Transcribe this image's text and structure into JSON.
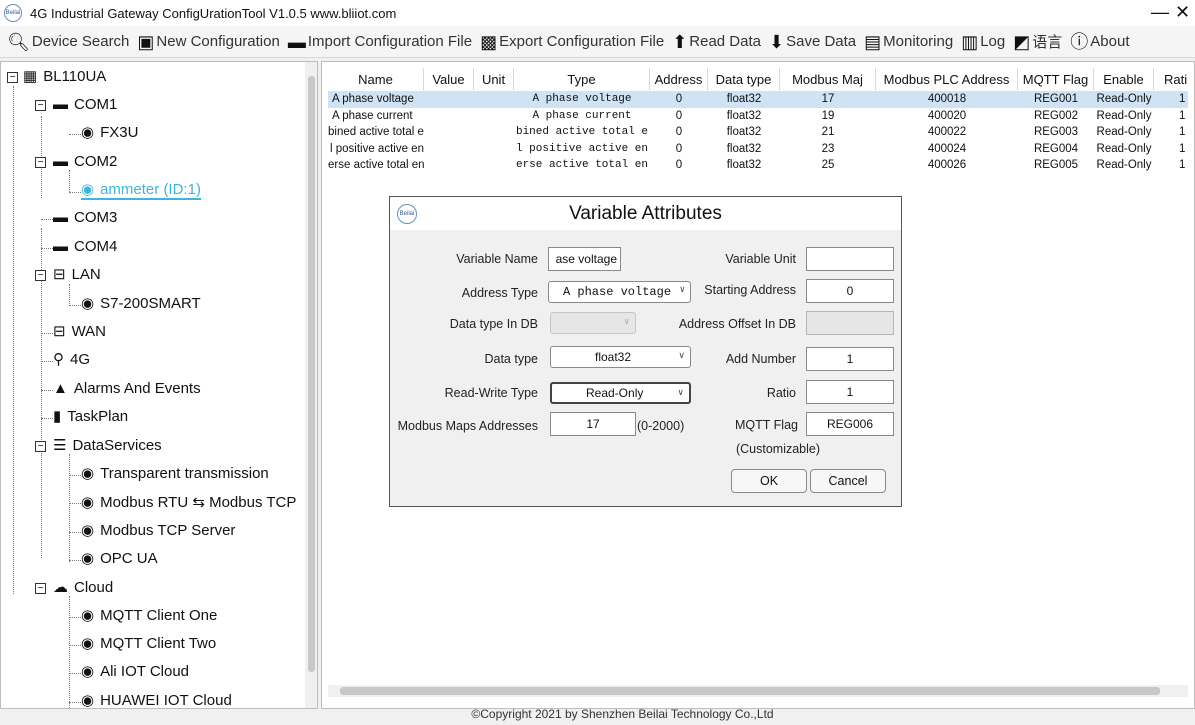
{
  "window": {
    "logo_text": "Beilai",
    "title": "4G Industrial Gateway ConfigUrationTool V1.0.5 www.bliiot.com",
    "minimize": "—",
    "close": "✕"
  },
  "toolbar": {
    "items": [
      {
        "label": "Device Search",
        "icon": "search-icon"
      },
      {
        "label": "New Configuration",
        "icon": "new-config-icon"
      },
      {
        "label": "Import Configuration File",
        "icon": "import-icon"
      },
      {
        "label": "Export Configuration File",
        "icon": "save-disk-icon"
      },
      {
        "label": "Read Data",
        "icon": "upload-arrow-icon"
      },
      {
        "label": "Save Data",
        "icon": "download-arrow-icon"
      },
      {
        "label": "Monitoring",
        "icon": "monitor-icon"
      },
      {
        "label": "Log",
        "icon": "log-icon"
      },
      {
        "label": "语言",
        "icon": "language-icon"
      },
      {
        "label": "About",
        "icon": "info-icon"
      }
    ]
  },
  "tree": {
    "root": "BL110UA",
    "com1": "COM1",
    "fx3u": "FX3U",
    "com2": "COM2",
    "ammeter": "ammeter  (ID:1)",
    "com3": "COM3",
    "com4": "COM4",
    "lan": "LAN",
    "s7": "S7-200SMART",
    "wan": "WAN",
    "g4": "4G",
    "alarms": "Alarms And Events",
    "taskplan": "TaskPlan",
    "dataservices": "DataServices",
    "transparent": "Transparent transmission",
    "modbus_rtu_tcp": "Modbus RTU ⇆ Modbus TCP",
    "modbus_tcp_server": "Modbus TCP Server",
    "opcua": "OPC UA",
    "cloud": "Cloud",
    "mqtt1": "MQTT Client One",
    "mqtt2": "MQTT Client Two",
    "ali": "Ali IOT Cloud",
    "huawei": "HUAWEI IOT Cloud"
  },
  "table": {
    "columns": [
      "Name",
      "Value",
      "Unit",
      "Type",
      "Address",
      "Data type",
      "Modbus Maj",
      "Modbus PLC Address",
      "MQTT Flag",
      "Enable",
      "Rati"
    ],
    "rows": [
      {
        "name": "A phase voltage",
        "value": "",
        "unit": "",
        "type": "A phase voltage",
        "address": "0",
        "dtype": "float32",
        "modbus": "17",
        "plc": "400018",
        "mqtt": "REG001",
        "enable": "Read-Only",
        "ratio": "1"
      },
      {
        "name": "A phase current",
        "value": "",
        "unit": "",
        "type": "A phase current",
        "address": "0",
        "dtype": "float32",
        "modbus": "19",
        "plc": "400020",
        "mqtt": "REG002",
        "enable": "Read-Only",
        "ratio": "1"
      },
      {
        "name": "bined active total e",
        "value": "",
        "unit": "",
        "type": "bined active total e",
        "address": "0",
        "dtype": "float32",
        "modbus": "21",
        "plc": "400022",
        "mqtt": "REG003",
        "enable": "Read-Only",
        "ratio": "1"
      },
      {
        "name": "l positive active en",
        "value": "",
        "unit": "",
        "type": "l positive active en",
        "address": "0",
        "dtype": "float32",
        "modbus": "23",
        "plc": "400024",
        "mqtt": "REG004",
        "enable": "Read-Only",
        "ratio": "1"
      },
      {
        "name": "erse active total en",
        "value": "",
        "unit": "",
        "type": "erse active total en",
        "address": "0",
        "dtype": "float32",
        "modbus": "25",
        "plc": "400026",
        "mqtt": "REG005",
        "enable": "Read-Only",
        "ratio": "1"
      }
    ]
  },
  "dialog": {
    "logo_text": "Beilai",
    "title": "Variable Attributes",
    "variable_name_label": "Variable Name",
    "variable_name_value": "ase voltage",
    "variable_unit_label": "Variable Unit",
    "variable_unit_value": "",
    "address_type_label": "Address Type",
    "address_type_value": "A phase voltage",
    "starting_address_label": "Starting Address",
    "starting_address_value": "0",
    "data_type_in_db_label": "Data type In DB",
    "data_type_in_db_value": "",
    "address_offset_label": "Address Offset In DB",
    "address_offset_value": "",
    "data_type_label": "Data type",
    "data_type_value": "float32",
    "add_number_label": "Add Number",
    "add_number_value": "1",
    "rw_type_label": "Read-Write Type",
    "rw_type_value": "Read-Only",
    "ratio_label": "Ratio",
    "ratio_value": "1",
    "modbus_maps_label": "Modbus Maps Addresses",
    "modbus_maps_value": "17",
    "modbus_range": "(0-2000)",
    "mqtt_flag_label": "MQTT Flag",
    "mqtt_flag_note": "(Customizable)",
    "mqtt_flag_value": "REG006",
    "ok": "OK",
    "cancel": "Cancel"
  },
  "footer": "©Copyright 2021 by Shenzhen Beilai Technology Co.,Ltd"
}
